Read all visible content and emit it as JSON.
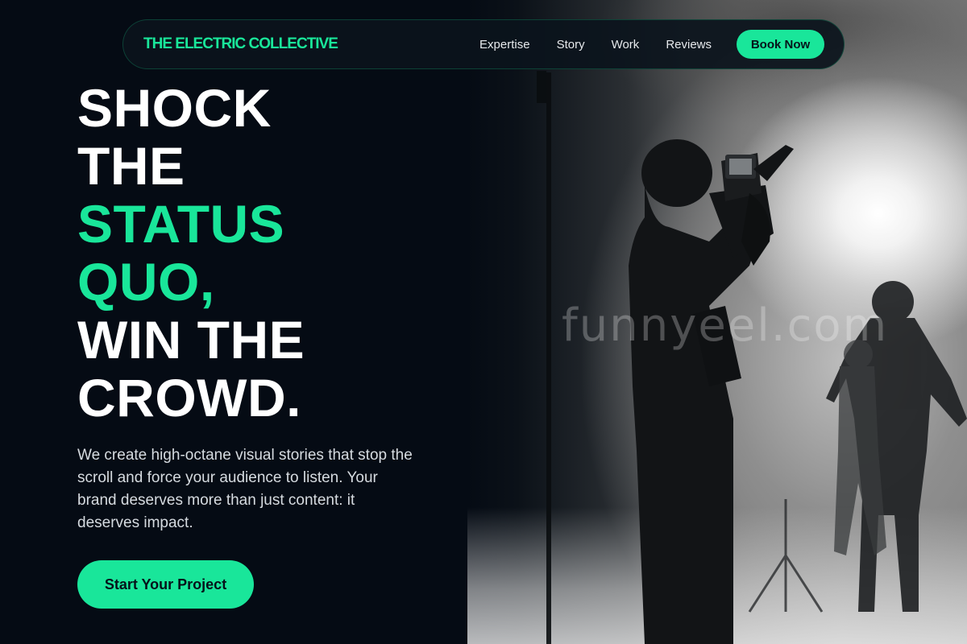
{
  "brand": {
    "name": "THE ELECTRIC COLLECTIVE"
  },
  "nav": {
    "links": [
      "Expertise",
      "Story",
      "Work",
      "Reviews"
    ],
    "cta_label": "Book Now"
  },
  "hero": {
    "headline_lines": [
      {
        "text": "SHOCK",
        "accent": false
      },
      {
        "text": "THE",
        "accent": false
      },
      {
        "text": "STATUS",
        "accent": true
      },
      {
        "text": "QUO,",
        "accent": true
      },
      {
        "text": "WIN THE",
        "accent": false
      },
      {
        "text": "CROWD.",
        "accent": false
      }
    ],
    "subtext": "We create high-octane visual stories that stop the scroll and force your audience to listen. Your brand deserves more than just content: it deserves impact.",
    "cta_label": "Start Your Project",
    "image_description_icon": "camera-operator-photo",
    "watermark": "funnyeel.com"
  },
  "colors": {
    "background": "#050b14",
    "accent": "#19e69a",
    "text": "#ffffff"
  }
}
